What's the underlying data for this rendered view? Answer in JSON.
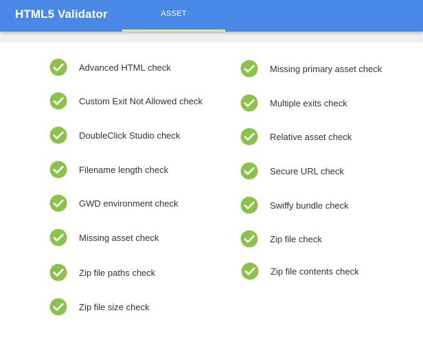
{
  "header": {
    "title": "HTML5 Validator",
    "tabs": [
      {
        "label": "ASSET",
        "active": true
      }
    ]
  },
  "colors": {
    "header_bg": "#4a88e8",
    "tab_indicator": "#e6ef7e",
    "check_green": "#8bc34a",
    "text": "#333333"
  },
  "checks": {
    "left": [
      {
        "label": "Advanced HTML check",
        "status": "passed",
        "icon": "check-circle-icon"
      },
      {
        "label": "Custom Exit Not Allowed check",
        "status": "passed",
        "icon": "check-circle-icon"
      },
      {
        "label": "DoubleClick Studio check",
        "status": "passed",
        "icon": "check-circle-icon"
      },
      {
        "label": "Filename length check",
        "status": "passed",
        "icon": "check-circle-icon"
      },
      {
        "label": "GWD environment check",
        "status": "passed",
        "icon": "check-circle-icon"
      },
      {
        "label": "Missing asset check",
        "status": "passed",
        "icon": "check-circle-icon"
      },
      {
        "label": "Zip file paths check",
        "status": "passed",
        "icon": "check-circle-icon"
      },
      {
        "label": "Zip file size check",
        "status": "passed",
        "icon": "check-circle-icon"
      }
    ],
    "right": [
      {
        "label": "Missing primary asset check",
        "status": "passed",
        "icon": "check-circle-icon"
      },
      {
        "label": "Multiple exits check",
        "status": "passed",
        "icon": "check-circle-icon"
      },
      {
        "label": "Relative asset check",
        "status": "passed",
        "icon": "check-circle-icon"
      },
      {
        "label": "Secure URL check",
        "status": "passed",
        "icon": "check-circle-icon"
      },
      {
        "label": "Swiffy bundle check",
        "status": "passed",
        "icon": "check-circle-icon"
      },
      {
        "label": "Zip file check",
        "status": "passed",
        "icon": "check-circle-icon"
      },
      {
        "label": "Zip file contents check",
        "status": "passed",
        "icon": "check-circle-icon"
      }
    ]
  }
}
